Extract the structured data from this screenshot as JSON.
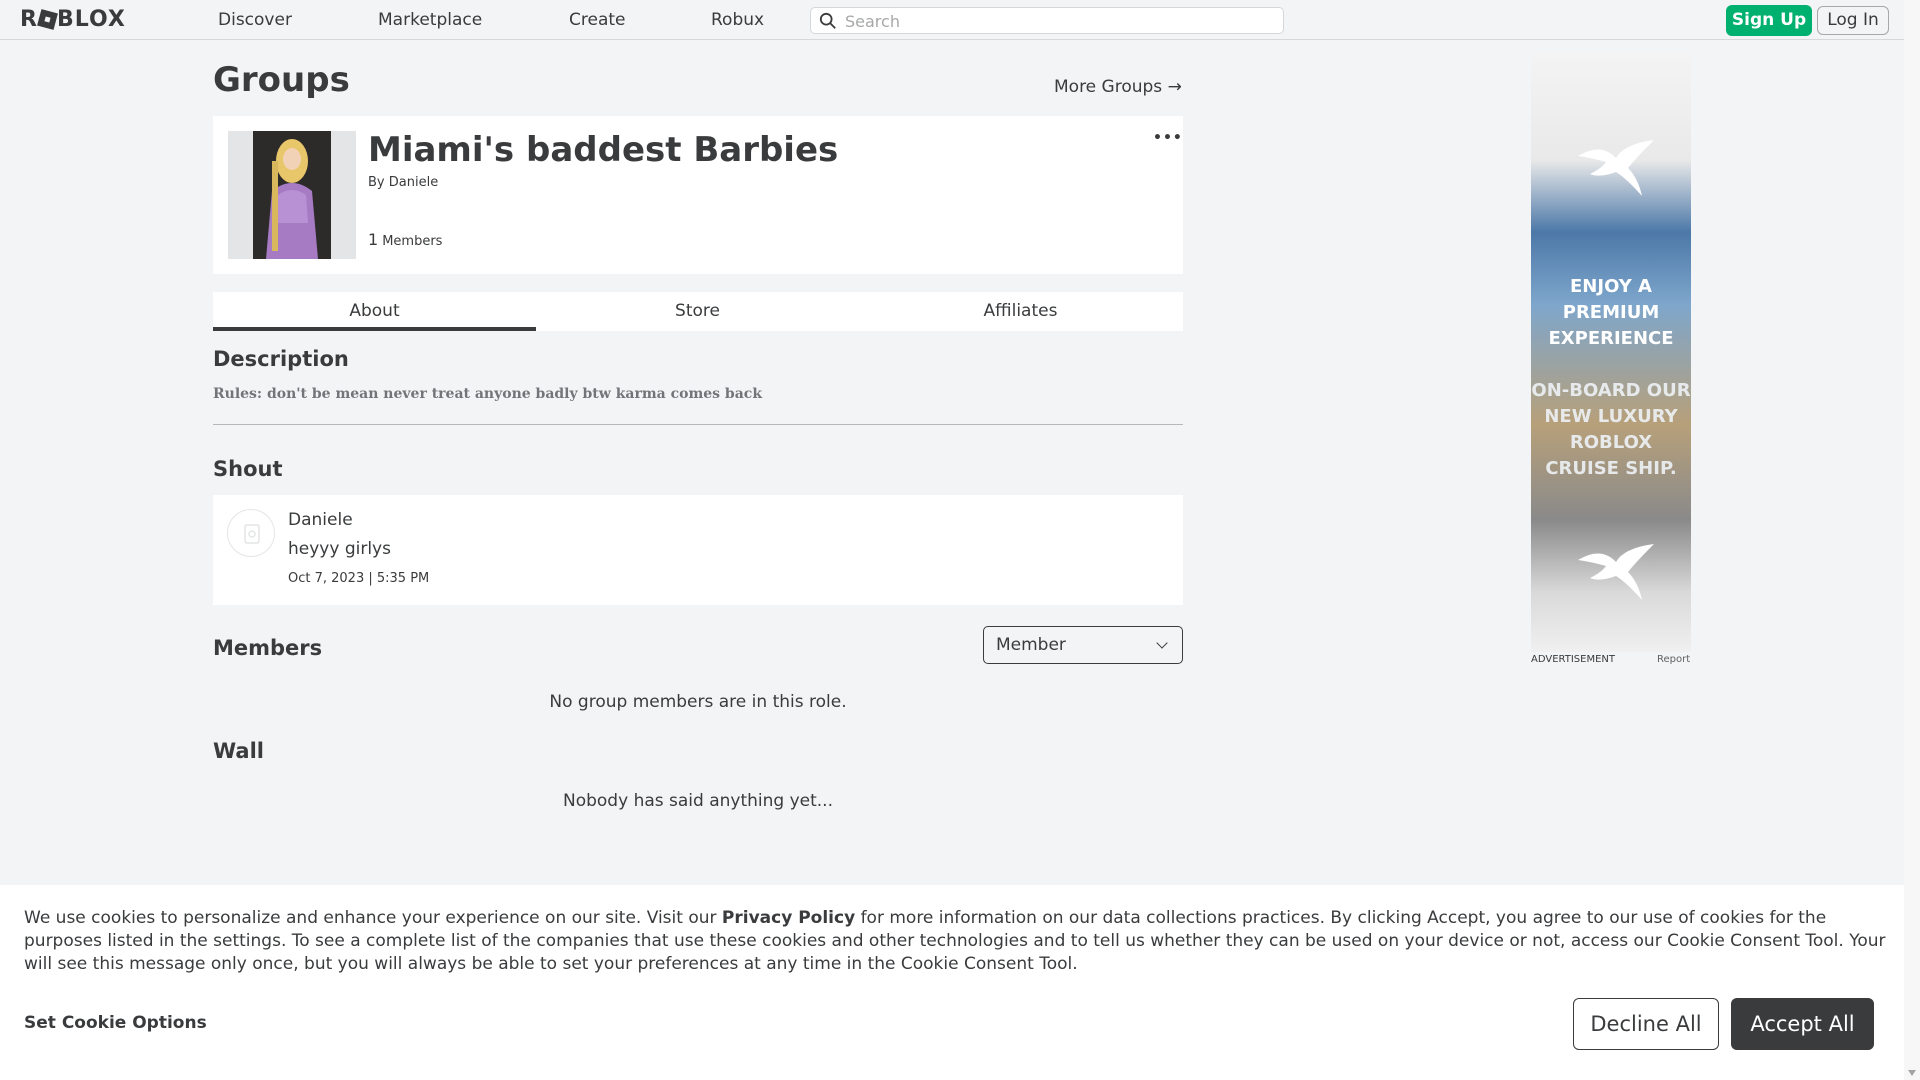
{
  "header": {
    "logo_text": "ROBLOX",
    "nav": [
      "Discover",
      "Marketplace",
      "Create",
      "Robux"
    ],
    "search_placeholder": "Search",
    "signup_label": "Sign Up",
    "login_label": "Log In"
  },
  "page": {
    "title": "Groups",
    "more_groups_label": "More Groups →"
  },
  "group": {
    "name": "Miami's baddest Barbies",
    "by_prefix": "By",
    "owner": "Daniele",
    "member_count": "1",
    "member_label": "Members",
    "more_menu": "•••"
  },
  "tabs": [
    {
      "label": "About",
      "active": true
    },
    {
      "label": "Store",
      "active": false
    },
    {
      "label": "Affiliates",
      "active": false
    }
  ],
  "description": {
    "title": "Description",
    "text": "Rules: don't be mean never treat anyone badly btw karma comes back"
  },
  "shout": {
    "title": "Shout",
    "user": "Daniele",
    "body": "heyyy girlys",
    "date": "Oct 7, 2023 | 5:35 PM"
  },
  "members": {
    "title": "Members",
    "role_selected": "Member",
    "empty_text": "No group members are in this role."
  },
  "wall": {
    "title": "Wall",
    "empty_text": "Nobody has said anything yet..."
  },
  "ad": {
    "line1": "ENJOY A PREMIUM EXPERIENCE",
    "line2": "ON-BOARD OUR NEW LUXURY ROBLOX CRUISE SHIP.",
    "label": "ADVERTISEMENT",
    "report": "Report"
  },
  "cookie": {
    "text_before": "We use cookies to personalize and enhance your experience on our site. Visit our ",
    "link": "Privacy Policy",
    "text_after": " for more information on our data collections practices. By clicking Accept, you agree to our use of cookies for the purposes listed in the settings. To see a complete list of the companies that use these cookies and other technologies and to tell us whether they can be used on your device or not, access our Cookie Consent Tool. Your will see this message only once, but you will always be able to set your preferences at any time in the Cookie Consent Tool.",
    "options_label": "Set Cookie Options",
    "decline_label": "Decline All",
    "accept_label": "Accept All"
  },
  "colors": {
    "brand_green": "#00b06f",
    "text": "#393b3d",
    "background": "#f2f4f5"
  }
}
